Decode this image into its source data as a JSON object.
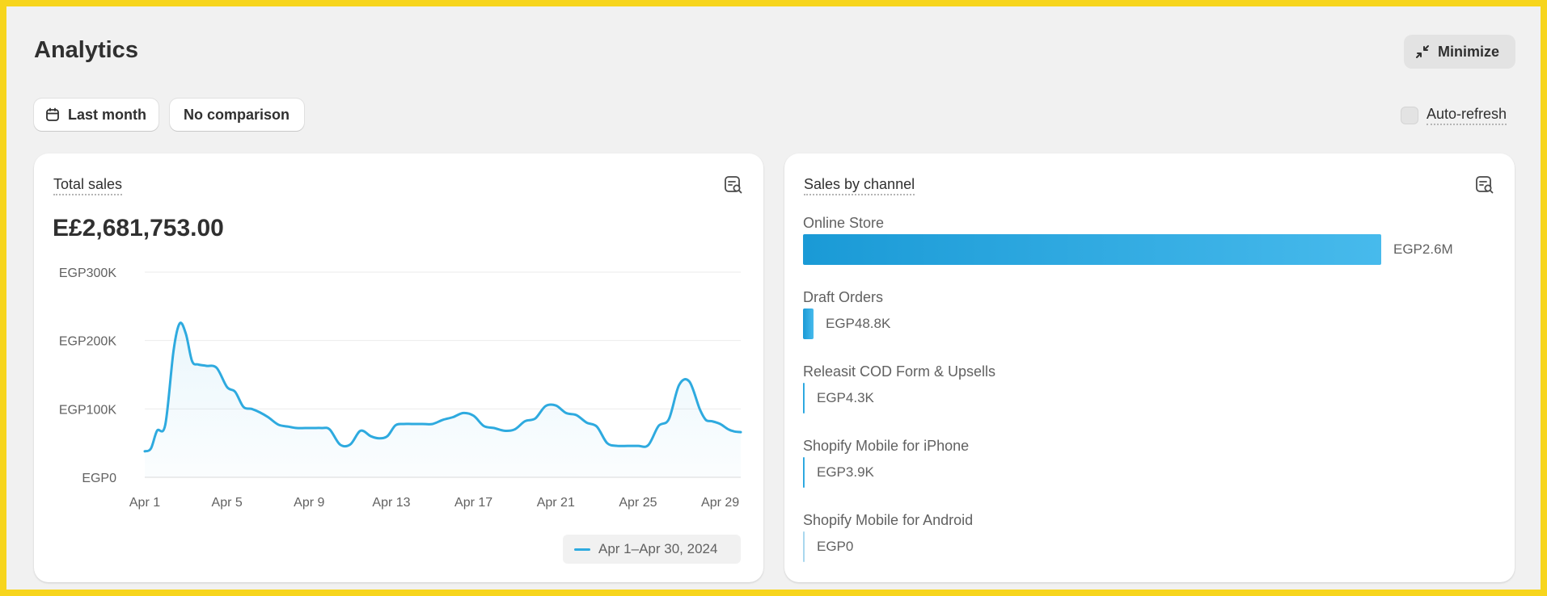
{
  "page": {
    "title": "Analytics",
    "minimize_label": "Minimize",
    "date_filter_label": "Last month",
    "comparison_label": "No comparison",
    "auto_refresh_label": "Auto-refresh"
  },
  "total_sales": {
    "title": "Total sales",
    "value": "E£2,681,753.00",
    "legend": "Apr 1–Apr 30, 2024",
    "icon": "report-search-icon"
  },
  "chart_data": {
    "type": "area",
    "title": "Total sales",
    "x_ticks": [
      "Apr 1",
      "Apr 5",
      "Apr 9",
      "Apr 13",
      "Apr 17",
      "Apr 21",
      "Apr 25",
      "Apr 29"
    ],
    "y_ticks": [
      "EGP300K",
      "EGP200K",
      "EGP100K",
      "EGP0"
    ],
    "ylim": [
      0,
      300000
    ],
    "xlim": [
      1,
      30
    ],
    "series": [
      {
        "name": "Apr 1–Apr 30, 2024",
        "color": "#2eaadf",
        "x": [
          1,
          1.3,
          1.6,
          2,
          2.4,
          2.7,
          3,
          3.3,
          3.6,
          4,
          4.5,
          5,
          5.4,
          5.8,
          6.2,
          6.6,
          7,
          7.5,
          8,
          8.4,
          8.8,
          9.2,
          9.6,
          10,
          10.5,
          11,
          11.5,
          12,
          12.4,
          12.8,
          13.2,
          13.6,
          14,
          14.5,
          15,
          15.5,
          16,
          16.5,
          17,
          17.5,
          18,
          18.5,
          19,
          19.5,
          20,
          20.5,
          21,
          21.5,
          22,
          22.5,
          23,
          23.5,
          24,
          24.5,
          25,
          25.5,
          26,
          26.5,
          27,
          27.5,
          28,
          28.3,
          28.6,
          29,
          29.4,
          29.7,
          30
        ],
        "y": [
          38000,
          42000,
          68000,
          77000,
          185000,
          225000,
          210000,
          170000,
          165000,
          163000,
          160000,
          132000,
          125000,
          103000,
          100000,
          95000,
          88000,
          77000,
          74000,
          72000,
          72000,
          72000,
          72000,
          70000,
          48000,
          48000,
          68000,
          60000,
          57000,
          60000,
          76000,
          78000,
          78000,
          78000,
          78000,
          84000,
          88000,
          94000,
          90000,
          75000,
          72000,
          68000,
          70000,
          82000,
          86000,
          104000,
          105000,
          94000,
          91000,
          80000,
          74000,
          50000,
          46000,
          46000,
          46000,
          47000,
          75000,
          85000,
          135000,
          140000,
          100000,
          84000,
          82000,
          78000,
          70000,
          67000,
          66000
        ]
      }
    ],
    "grid": true
  },
  "sales_by_channel": {
    "title": "Sales by channel",
    "icon": "report-search-icon",
    "channels": [
      {
        "name": "Online Store",
        "value_label": "EGP2.6M",
        "value": 2600000
      },
      {
        "name": "Draft Orders",
        "value_label": "EGP48.8K",
        "value": 48800
      },
      {
        "name": "Releasit COD Form & Upsells",
        "value_label": "EGP4.3K",
        "value": 4300
      },
      {
        "name": "Shopify Mobile for iPhone",
        "value_label": "EGP3.9K",
        "value": 3900
      },
      {
        "name": "Shopify Mobile for Android",
        "value_label": "EGP0",
        "value": 0
      }
    ]
  },
  "colors": {
    "accent": "#2eaadf",
    "frame": "#f7d51d",
    "background": "#f1f1f1"
  }
}
